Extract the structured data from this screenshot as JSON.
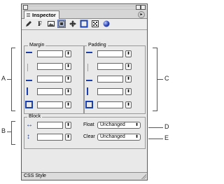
{
  "callouts": {
    "a": "A",
    "b": "B",
    "c": "C",
    "d": "D",
    "e": "E"
  },
  "panel": {
    "tab_label": "Inspector",
    "toolbar_icons": [
      "pen-icon",
      "font-icon",
      "image-icon",
      "box-icon",
      "move-icon",
      "border-icon",
      "pattern-icon",
      "sphere-icon"
    ],
    "margin_label": "Margin",
    "padding_label": "Padding",
    "margin_values": [
      "",
      "",
      "",
      "",
      ""
    ],
    "padding_values": [
      "",
      "",
      "",
      "",
      ""
    ],
    "block_label": "Block",
    "width_value": "",
    "height_value": "",
    "float_label": "Float",
    "float_value": "Unchanged",
    "clear_label": "Clear",
    "clear_value": "Unchanged",
    "status_text": "CSS Style"
  }
}
